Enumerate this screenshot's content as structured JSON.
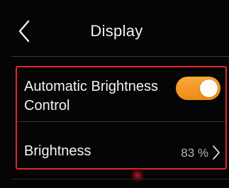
{
  "header": {
    "title": "Display",
    "back_icon": "chevron-left-icon"
  },
  "settings": {
    "automatic_brightness": {
      "label": "Automatic Brightness Control",
      "enabled": true,
      "toggle_color": "#f59e28"
    },
    "brightness": {
      "label": "Brightness",
      "value": "83 %",
      "chevron_icon": "chevron-right-icon"
    }
  },
  "colors": {
    "highlight_border": "#e0262b",
    "background": "#050505"
  }
}
